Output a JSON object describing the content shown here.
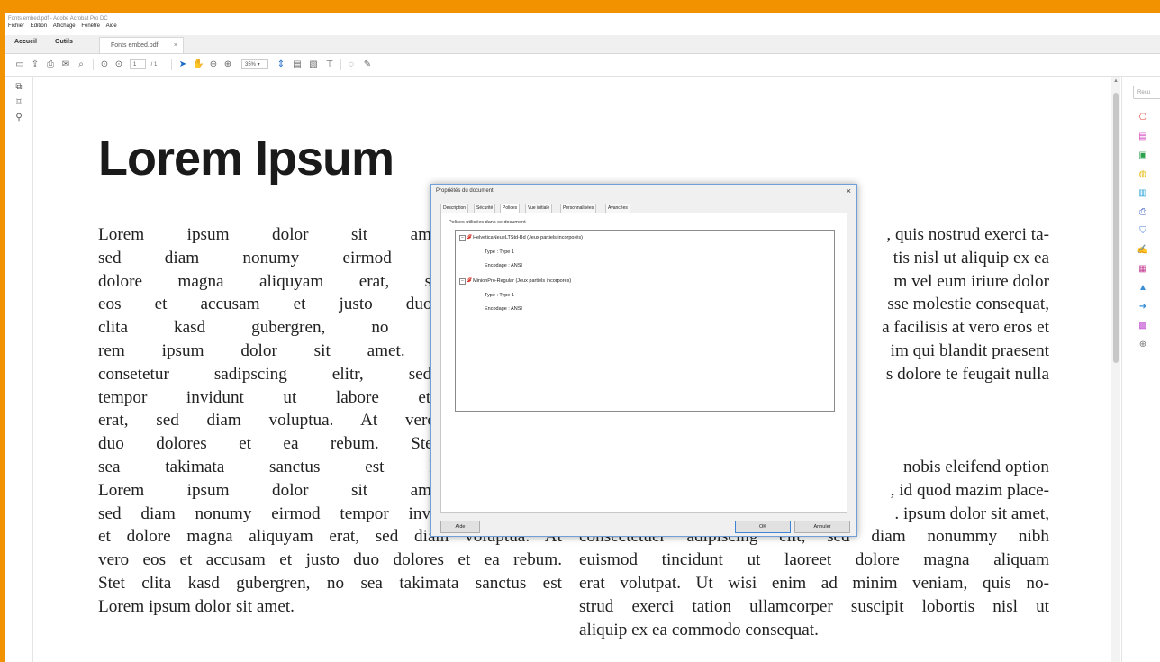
{
  "window": {
    "title": "Fonts embed.pdf - Adobe Acrobat Pro DC"
  },
  "menu": [
    "Fichier",
    "Edition",
    "Affichage",
    "Fenêtre",
    "Aide"
  ],
  "tabs": {
    "home": "Accueil",
    "tools": "Outils",
    "document": "Fonts embed.pdf"
  },
  "toolbar": {
    "page_current": "1",
    "page_total": "/ 1",
    "zoom": "35%"
  },
  "document": {
    "heading": "Lorem Ipsum",
    "col1_lines": [
      "Lorem ipsum dolor sit amet, consetetur",
      "sed diam nonumy eirmod tempor invic",
      "dolore magna aliquyam erat, sed diam v",
      "eos et accusam et justo duo dolores et",
      "clita kasd gubergren, no sea takimata",
      "rem ipsum dolor sit amet. Lorem ipsun",
      "consetetur sadipscing elitr, sed diam r",
      "tempor invidunt ut labore et dolore n",
      "erat, sed diam voluptua. At vero eos et a",
      "duo dolores et ea rebum. Stet clita kasc",
      "sea takimata sanctus est Lorem ipsum",
      "Lorem ipsum dolor sit amet, consetetur",
      "sed diam nonumy eirmod tempor invidunt ut labore",
      "et dolore magna aliquyam erat, sed diam voluptua. At",
      "vero eos et accusam et justo duo dolores et ea rebum.",
      "Stet clita kasd gubergren, no sea takimata sanctus est",
      "Lorem ipsum dolor sit amet."
    ],
    "col2_lines": [
      ", quis nostrud exerci ta-",
      "tis nisl ut aliquip ex ea",
      "m vel eum iriure dolor",
      "sse molestie consequat,",
      "a facilisis at vero eros et",
      "im qui blandit praesent",
      "s dolore te feugait nulla"
    ],
    "col2b_lines": [
      "nobis eleifend option",
      ", id quod mazim place-",
      ". ipsum dolor sit amet,",
      "consectetuer adipiscing elit, sed diam nonummy nibh",
      "euismod tincidunt ut laoreet dolore magna aliquam",
      "erat volutpat. Ut wisi enim ad minim veniam, quis no-",
      "strud exerci tation ullamcorper suscipit lobortis nisl ut",
      "aliquip ex ea commodo consequat."
    ]
  },
  "right_pane": {
    "search_placeholder": "Recu"
  },
  "dialog": {
    "title": "Propriétés du document",
    "tabs": [
      "Description",
      "Sécurité",
      "Polices",
      "Vue initiale",
      "Personnalisées",
      "Avancées"
    ],
    "active_tab": "Polices",
    "group_label": "Polices utilisées dans ce document",
    "fonts": [
      {
        "name": "HelveticaNeueLTStd-Bd (Jeux partiels incorporés)",
        "type": "Type : Type 1",
        "encoding": "Encodage : ANSI"
      },
      {
        "name": "MinionPro-Regular (Jeux partiels incorporés)",
        "type": "Type : Type 1",
        "encoding": "Encodage : ANSI"
      }
    ],
    "help_button": "Aide",
    "ok_button": "OK",
    "cancel_button": "Annuler"
  },
  "colors": {
    "frame": "#f39200",
    "font_icon": "#d6261c",
    "accent": "#1a6bc7"
  }
}
